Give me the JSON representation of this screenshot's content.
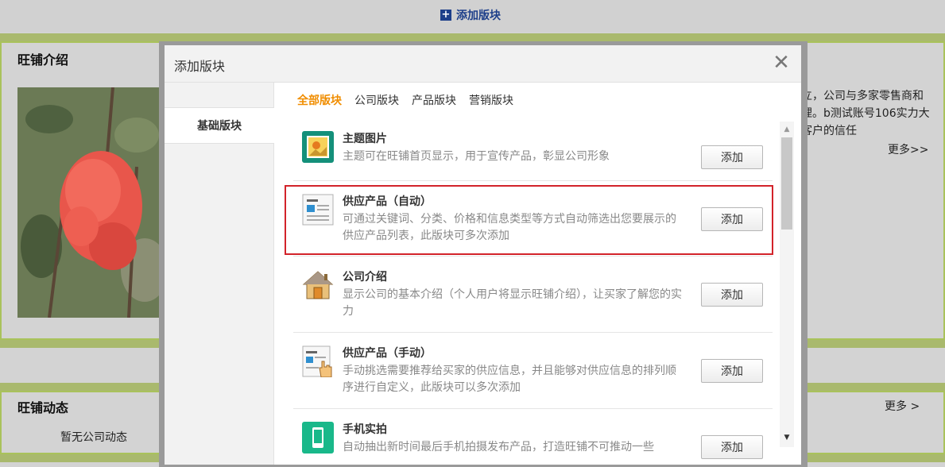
{
  "background": {
    "add_block_label": "添加版块",
    "shop_intro_title": "旺铺介绍",
    "shop_intro_text": "立，公司与多家零售商和理。b测试账号106实力大客户的信任",
    "shop_intro_more": "更多>>",
    "news_title": "旺铺动态",
    "news_more": "更多 >",
    "news_empty": "暂无公司动态"
  },
  "modal": {
    "title": "添加版块",
    "close_symbol": "✕",
    "side_tab": "基础版块",
    "tabs": [
      {
        "label": "全部版块",
        "active": true
      },
      {
        "label": "公司版块",
        "active": false
      },
      {
        "label": "产品版块",
        "active": false
      },
      {
        "label": "营销版块",
        "active": false
      }
    ],
    "items": [
      {
        "name": "主题图片",
        "desc": "主题可在旺铺首页显示，用于宣传产品，彰显公司形象",
        "button": "添加",
        "icon": "theme-image-icon"
      },
      {
        "name": "供应产品（自动）",
        "desc": "可通过关键词、分类、价格和信息类型等方式自动筛选出您要展示的供应产品列表，此版块可多次添加",
        "button": "添加",
        "icon": "document-list-icon"
      },
      {
        "name": "公司介绍",
        "desc": "显示公司的基本介绍（个人用户将显示旺铺介绍），让买家了解您的实力",
        "button": "添加",
        "icon": "house-icon"
      },
      {
        "name": "供应产品（手动）",
        "desc": "手动挑选需要推荐给买家的供应信息，并且能够对供应信息的排列顺序进行自定义，此版块可以多次添加",
        "button": "添加",
        "icon": "hand-document-icon"
      },
      {
        "name": "手机实拍",
        "desc": "自动抽出新时间最后手机拍摄发布产品，打造旺铺不可推动一些",
        "button": "添加",
        "icon": "phone-icon"
      }
    ]
  },
  "colors": {
    "accent_orange": "#f08d00",
    "highlight_red": "#d2232a",
    "brand_blue": "#1d3f8a",
    "band_green": "#a9c25b"
  }
}
